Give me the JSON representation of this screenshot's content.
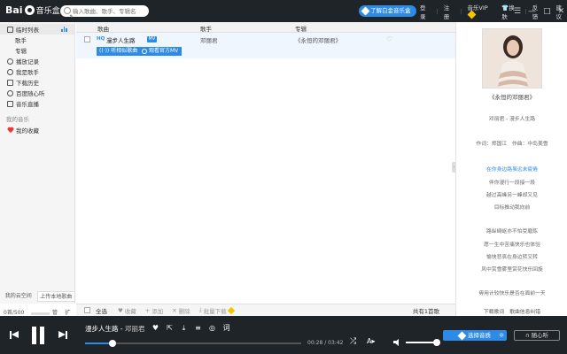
{
  "header": {
    "logo_text": "Bai",
    "logo_sub": "音乐盒",
    "search_placeholder": "输入歌曲、歌手、专辑名",
    "promo_label": "了解白金音乐盒",
    "links": [
      "登录",
      "注册",
      "音乐VIP",
      "换肤",
      "反馈",
      "建议"
    ]
  },
  "sidebar": {
    "items": [
      {
        "label": "临时列表",
        "icon": "list-icon"
      },
      {
        "label": "歌手",
        "icon": ""
      },
      {
        "label": "专辑",
        "icon": ""
      },
      {
        "label": "播放记录",
        "icon": "clock-icon"
      },
      {
        "label": "我是歌手",
        "icon": "mic-icon"
      },
      {
        "label": "下载历史",
        "icon": "download-icon"
      },
      {
        "label": "百度随心听",
        "icon": "radio-icon"
      },
      {
        "label": "音乐直播",
        "icon": "live-icon"
      }
    ],
    "my_music_title": "我的音乐",
    "favorites_label": "我的收藏",
    "space_tab_1": "我的云空间",
    "space_tab_2": "上传本地歌曲",
    "storage_text": "0首/500首",
    "storage_links": [
      "管理",
      "扩容"
    ]
  },
  "table": {
    "col_song": "歌曲",
    "col_artist": "歌手",
    "col_album": "专辑",
    "rows": [
      {
        "hq": "HQ",
        "title": "漫步人生路",
        "badge": "MV",
        "artist": "邓丽君",
        "album": "《永恒的邓丽君》"
      }
    ],
    "btn_hifi": "听相似歌曲",
    "btn_mv": "观看官方MV"
  },
  "toolbar": {
    "select_all": "全选",
    "collect": "收藏",
    "add": "添加",
    "delete": "删除",
    "batch_download": "批量下载",
    "count": "共有1首歌"
  },
  "right_panel": {
    "album_name": "《永恒的邓丽君》",
    "lyrics": [
      "邓丽君 - 漫步人生路",
      "作词：郑国江　作曲：中岛美雪",
      "在你身边路虽远未疲倦",
      "伴你漫行一段接一段",
      "越过高峰另一峰却又见",
      "目标推动我向前",
      "路纵崎岖亦不怕受磨炼",
      "愿一生中苦痛快乐也体验",
      "愉快悲哀在身边转又转",
      "风中赏雪雾里赏花快乐回旋",
      "毋用计较快乐是否在面前一天"
    ],
    "current_line": 2,
    "footer_links": [
      "下载歌词",
      "歌曲信息纠错"
    ]
  },
  "player": {
    "song": "漫步人生路",
    "separator": " - ",
    "artist": "邓丽君",
    "time": "00:28 / 03:42",
    "progress": 0.126,
    "volume": 1.0,
    "quality_label": "选择音质",
    "listen_label": "随心听"
  },
  "colors": {
    "accent": "#2d8ae6",
    "topbar": "#1f2429"
  }
}
